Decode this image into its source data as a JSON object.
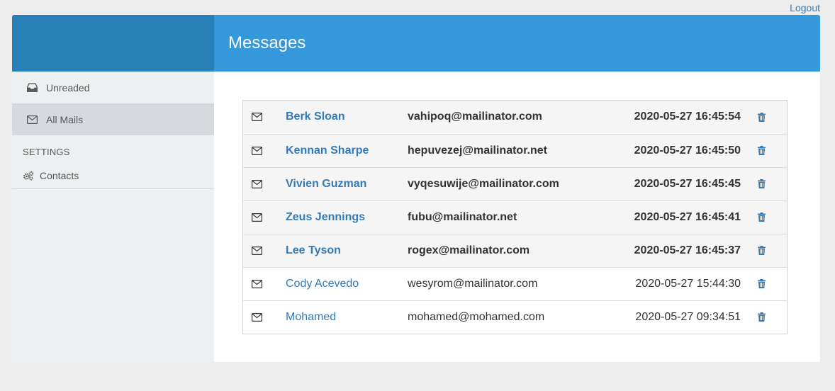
{
  "header": {
    "logout_label": "Logout"
  },
  "main": {
    "title": "Messages"
  },
  "sidebar": {
    "items": [
      {
        "label": "Unreaded",
        "icon": "inbox-icon"
      },
      {
        "label": "All Mails",
        "icon": "envelope-icon"
      }
    ],
    "settings_heading": "SETTINGS",
    "settings_items": [
      {
        "label": "Contacts",
        "icon": "gears-icon"
      }
    ]
  },
  "messages": [
    {
      "name": "Berk Sloan",
      "email": "vahipoq@mailinator.com",
      "date": "2020-05-27 16:45:54",
      "unread": true
    },
    {
      "name": "Kennan Sharpe",
      "email": "hepuvezej@mailinator.net",
      "date": "2020-05-27 16:45:50",
      "unread": true
    },
    {
      "name": "Vivien Guzman",
      "email": "vyqesuwije@mailinator.com",
      "date": "2020-05-27 16:45:45",
      "unread": true
    },
    {
      "name": "Zeus Jennings",
      "email": "fubu@mailinator.net",
      "date": "2020-05-27 16:45:41",
      "unread": true
    },
    {
      "name": "Lee Tyson",
      "email": "rogex@mailinator.com",
      "date": "2020-05-27 16:45:37",
      "unread": true
    },
    {
      "name": "Cody Acevedo",
      "email": "wesyrom@mailinator.com",
      "date": "2020-05-27 15:44:30",
      "unread": false
    },
    {
      "name": "Mohamed",
      "email": "mohamed@mohamed.com",
      "date": "2020-05-27 09:34:51",
      "unread": false
    }
  ],
  "colors": {
    "sidebar_header": "#2980b9",
    "main_header": "#3498db",
    "link": "#337ab7",
    "sidebar_bg": "#ecf0f1"
  }
}
